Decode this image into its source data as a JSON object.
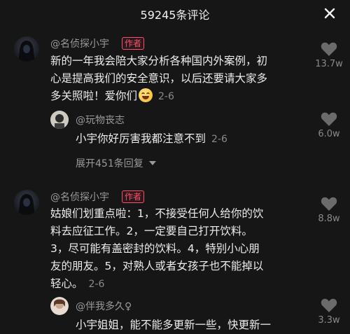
{
  "header": {
    "title": "59245条评论",
    "close_icon": "close-icon"
  },
  "comments": [
    {
      "username": "@名侦探小宇",
      "badge": "作者",
      "lines": [
        "新的一年我会陪大家分析各种国内外案例，初",
        "心是提高我们的安全意识，以后还要请大家多",
        "多关照啦！爱你们"
      ],
      "emoji": "smile-emoji",
      "time": "2-6",
      "likes": "13.7w",
      "reply": {
        "username": "@玩物丧志",
        "text": "小宇你好厉害我都注意不到",
        "time": "2-6",
        "likes": "6.0w"
      },
      "expand": "展开451条回复"
    },
    {
      "username": "@名侦探小宇",
      "badge": "作者",
      "lines": [
        "姑娘们划重点啦：1，不接受任何人给你的饮",
        "料去应征工作。2，一定要自己打开饮料。",
        "3，尽可能有盖密封的饮料。4，特别小心朋",
        "友的朋友。5，对熟人或者女孩子也不能掉以",
        "轻心。"
      ],
      "time": "2-6",
      "likes": "8.8w",
      "reply": {
        "username": "@伴我多久♀",
        "text": "小宇姐姐，能不能多更新一些，快更新一",
        "likes": "3.3w"
      }
    }
  ]
}
